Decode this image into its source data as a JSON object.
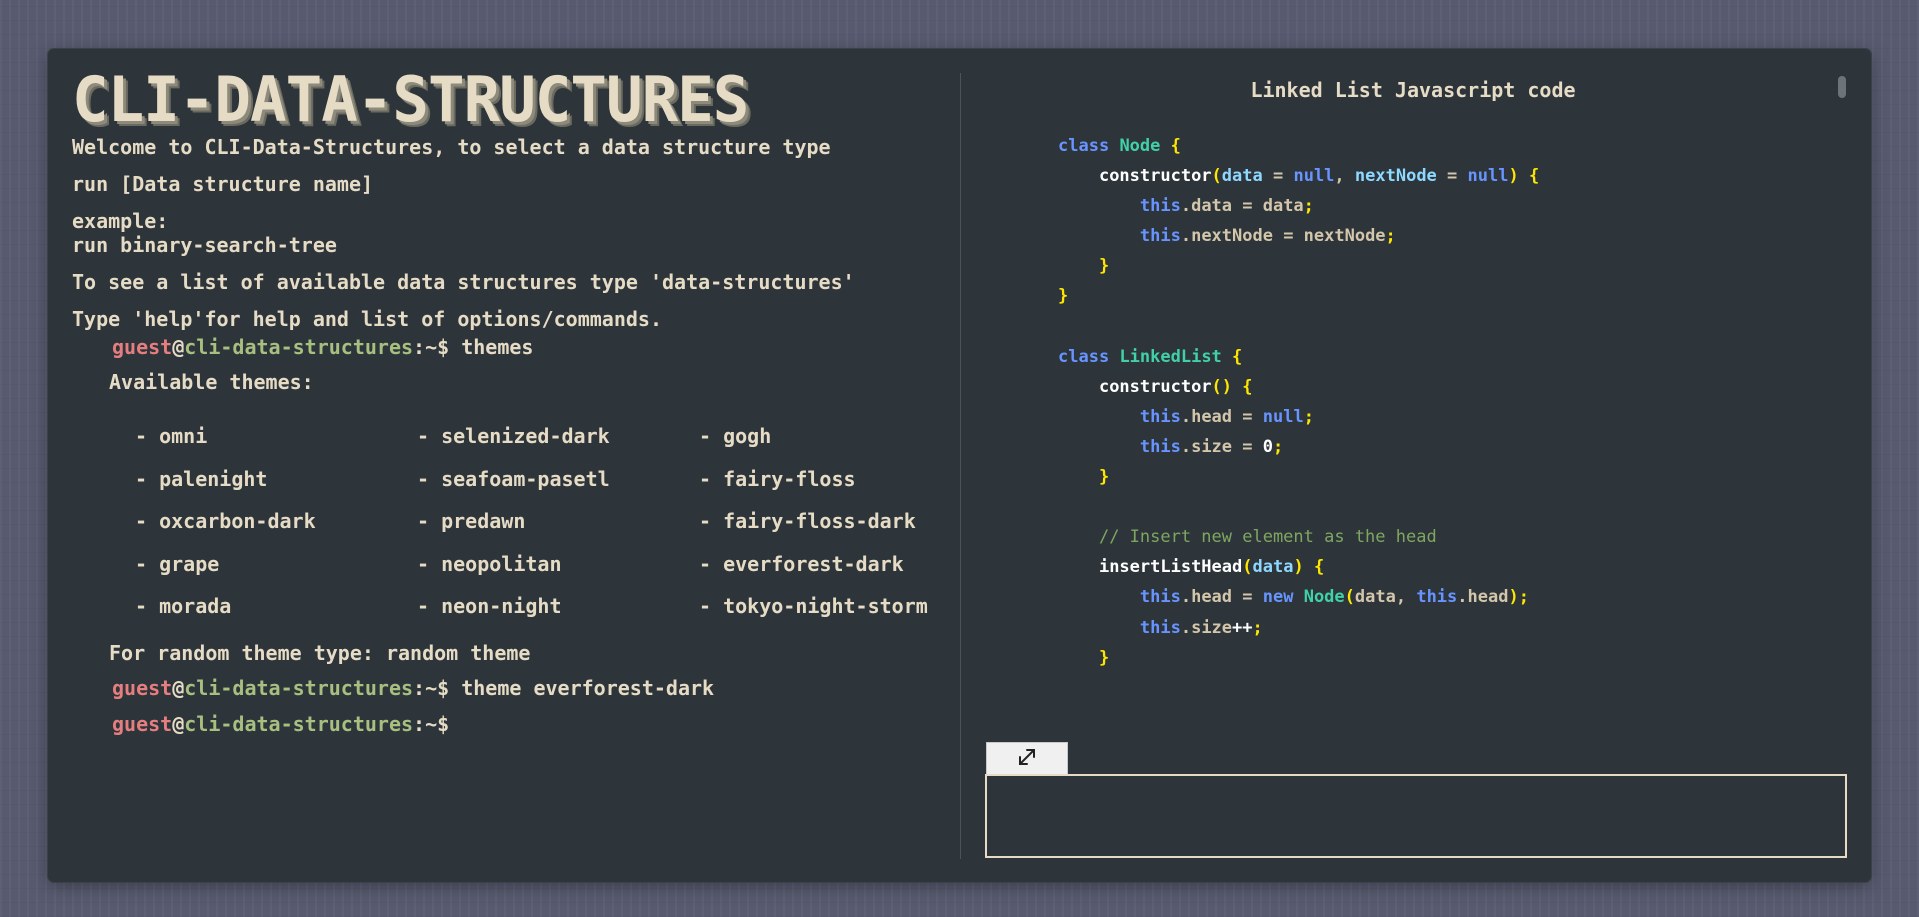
{
  "terminal": {
    "logo": "CLI-DATA-STRUCTURES",
    "intro": [
      "Welcome to CLI-Data-Structures, to select a data structure type",
      "run [Data structure name]",
      "example:",
      "run binary-search-tree",
      "To see a list of available data structures type 'data-structures'",
      "Type 'help'for help and list of options/commands."
    ],
    "prompt": {
      "user": "guest",
      "at": "@",
      "host": "cli-data-structures",
      "path": ":~$"
    },
    "commands": [
      "themes",
      "theme everforest-dark",
      ""
    ],
    "available_themes_label": "Available themes:",
    "themes": [
      [
        "- omni",
        "- selenized-dark",
        "- gogh"
      ],
      [
        "- palenight",
        "- seafoam-pasetl",
        "- fairy-floss"
      ],
      [
        "- oxcarbon-dark",
        "- predawn",
        "- fairy-floss-dark"
      ],
      [
        "- grape",
        "- neopolitan",
        "- everforest-dark"
      ],
      [
        "- morada",
        "- neon-night",
        "- tokyo-night-storm"
      ]
    ],
    "random_hint": "For random theme type: random theme"
  },
  "code_panel": {
    "title": "Linked List Javascript code",
    "expand_icon": "expand-arrows-icon"
  },
  "colors": {
    "background": "#2d353b",
    "text": "#e6dcc6",
    "user": "#e67e80",
    "host": "#a7c080",
    "keyword": "#6894ff",
    "class_name": "#41d1a9",
    "bracket": "#ffe600",
    "comment": "#7fa660"
  }
}
